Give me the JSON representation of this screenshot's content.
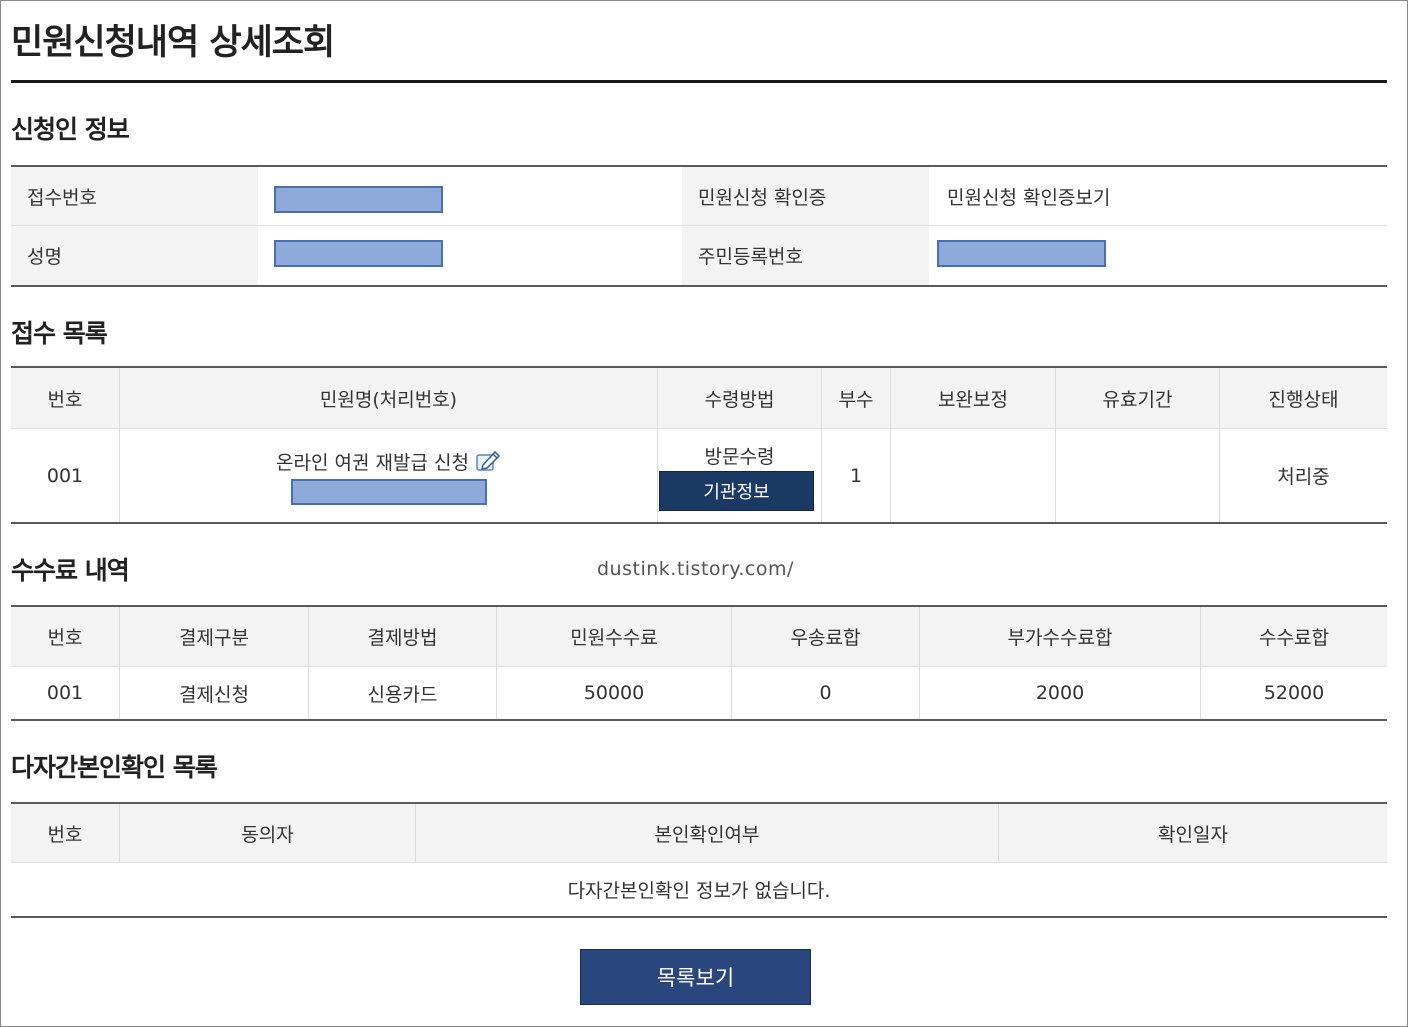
{
  "page": {
    "title": "민원신청내역 상세조회"
  },
  "applicant": {
    "section_title": "신청인 정보",
    "receipt_no_label": "접수번호",
    "certificate_label": "민원신청 확인증",
    "certificate_link": "민원신청 확인증보기",
    "name_label": "성명",
    "resident_no_label": "주민등록번호"
  },
  "receipt_list": {
    "section_title": "접수 목록",
    "headers": [
      "번호",
      "민원명(처리번호)",
      "수령방법",
      "부수",
      "보완보정",
      "유효기간",
      "진행상태"
    ],
    "row": {
      "no": "001",
      "name": "온라인 여권 재발급 신청",
      "receive_method": "방문수령",
      "agency_button": "기관정보",
      "copies": "1",
      "supplement": "",
      "validity": "",
      "status": "처리중"
    },
    "edit_icon": "edit-note-icon"
  },
  "watermark": "dustink.tistory.com/",
  "fee": {
    "section_title": "수수료 내역",
    "headers": [
      "번호",
      "결제구분",
      "결제방법",
      "민원수수료",
      "우송료합",
      "부가수수료합",
      "수수료합"
    ],
    "row": [
      "001",
      "결제신청",
      "신용카드",
      "50000",
      "0",
      "2000",
      "52000"
    ]
  },
  "identity": {
    "section_title": "다자간본인확인 목록",
    "headers": [
      "번호",
      "동의자",
      "본인확인여부",
      "확인일자"
    ],
    "empty_message": "다자간본인확인 정보가 없습니다."
  },
  "actions": {
    "list_button": "목록보기"
  },
  "colors": {
    "button": "#29467d",
    "agency_button": "#1b3a63",
    "redaction": "#8eaadb"
  }
}
